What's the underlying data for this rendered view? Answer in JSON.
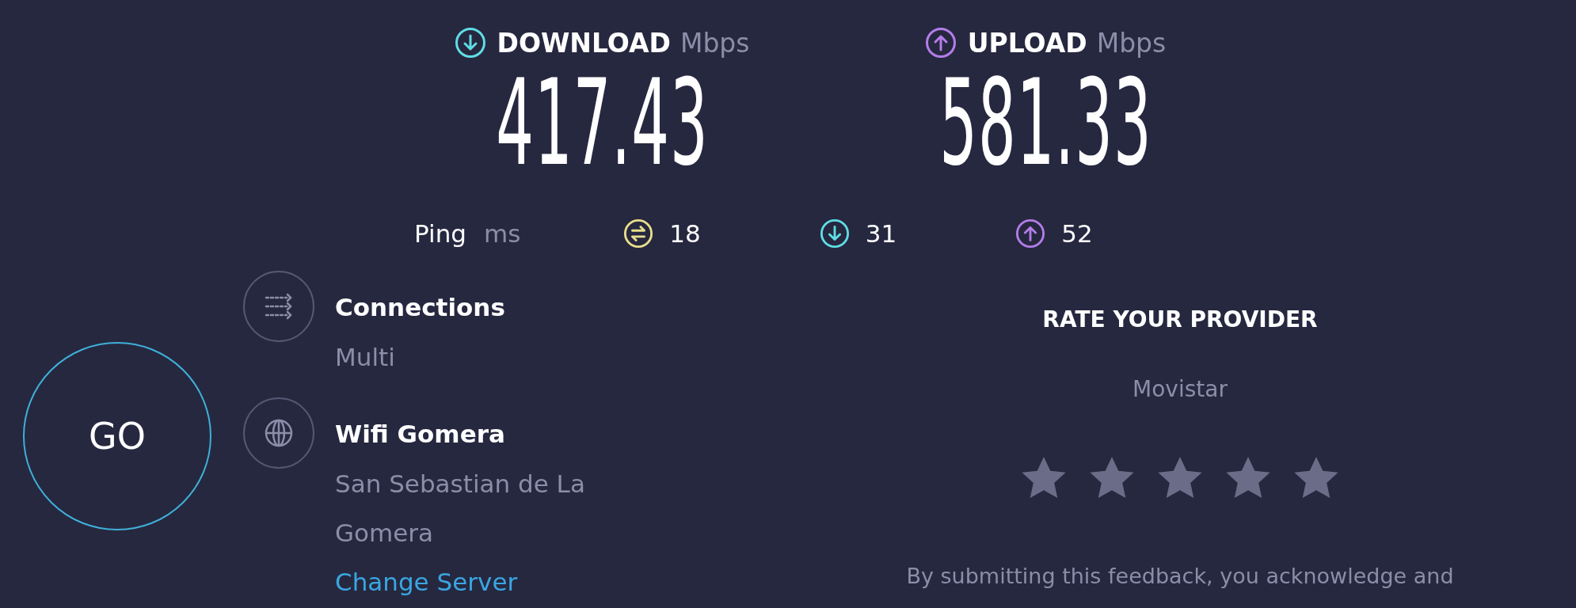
{
  "download": {
    "kind": "download",
    "label": "DOWNLOAD",
    "unit": "Mbps",
    "value": "417.43"
  },
  "upload": {
    "kind": "upload",
    "label": "UPLOAD",
    "unit": "Mbps",
    "value": "581.33"
  },
  "ping": {
    "label": "Ping",
    "unit": "ms",
    "readings": [
      {
        "kind": "idle",
        "value": "18"
      },
      {
        "kind": "download",
        "value": "31"
      },
      {
        "kind": "upload",
        "value": "52"
      }
    ]
  },
  "go_button": "GO",
  "connections": {
    "title": "Connections",
    "value": "Multi"
  },
  "server": {
    "name": "Wifi Gomera",
    "location": "San Sebastian de La Gomera",
    "link": "Change Server"
  },
  "rating": {
    "title": "RATE YOUR PROVIDER",
    "provider": "Movistar",
    "notice": "By submitting this feedback, you acknowledge and"
  }
}
